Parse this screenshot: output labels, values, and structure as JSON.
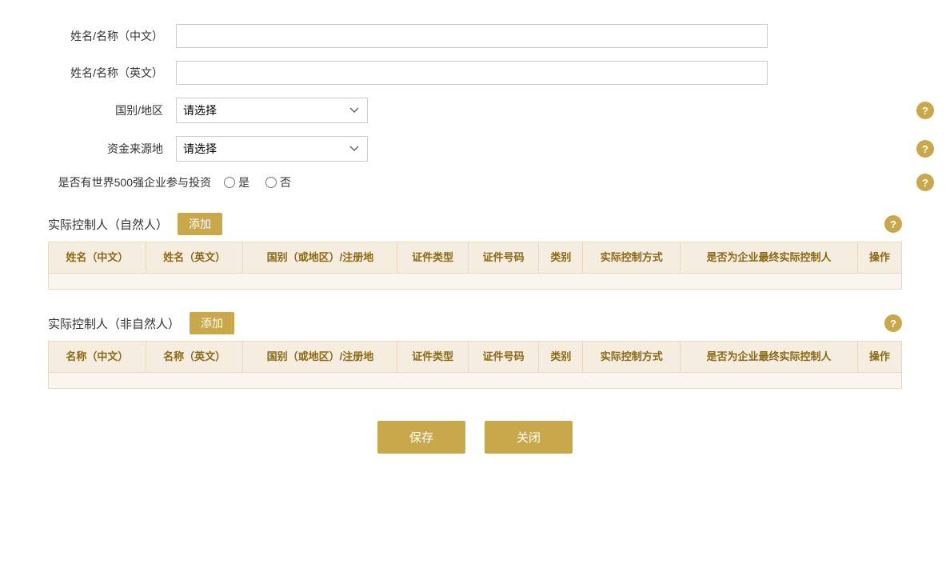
{
  "form": {
    "name_cn_label": "姓名/名称（中文）",
    "name_en_label": "姓名/名称（英文）",
    "country_label": "国别/地区",
    "fund_source_label": "资金来源地",
    "fortune500_label": "是否有世界500强企业参与投资",
    "country_placeholder": "请选择",
    "fund_source_placeholder": "请选择",
    "radio_yes": "是",
    "radio_no": "否"
  },
  "natural_person_section": {
    "title": "实际控制人（自然人）",
    "add_label": "添加",
    "help_icon": "?",
    "columns": [
      "姓名（中文）",
      "姓名（英文）",
      "国别（或地区）/注册地",
      "证件类型",
      "证件号码",
      "类别",
      "实际控制方式",
      "是否为企业最终实际控制人",
      "操作"
    ]
  },
  "non_natural_person_section": {
    "title": "实际控制人（非自然人）",
    "add_label": "添加",
    "help_icon": "?",
    "columns": [
      "名称（中文）",
      "名称（英文）",
      "国别（或地区）/注册地",
      "证件类型",
      "证件号码",
      "类别",
      "实际控制方式",
      "是否为企业最终实际控制人",
      "操作"
    ]
  },
  "buttons": {
    "save": "保存",
    "close": "关闭"
  },
  "icons": {
    "help": "?"
  }
}
